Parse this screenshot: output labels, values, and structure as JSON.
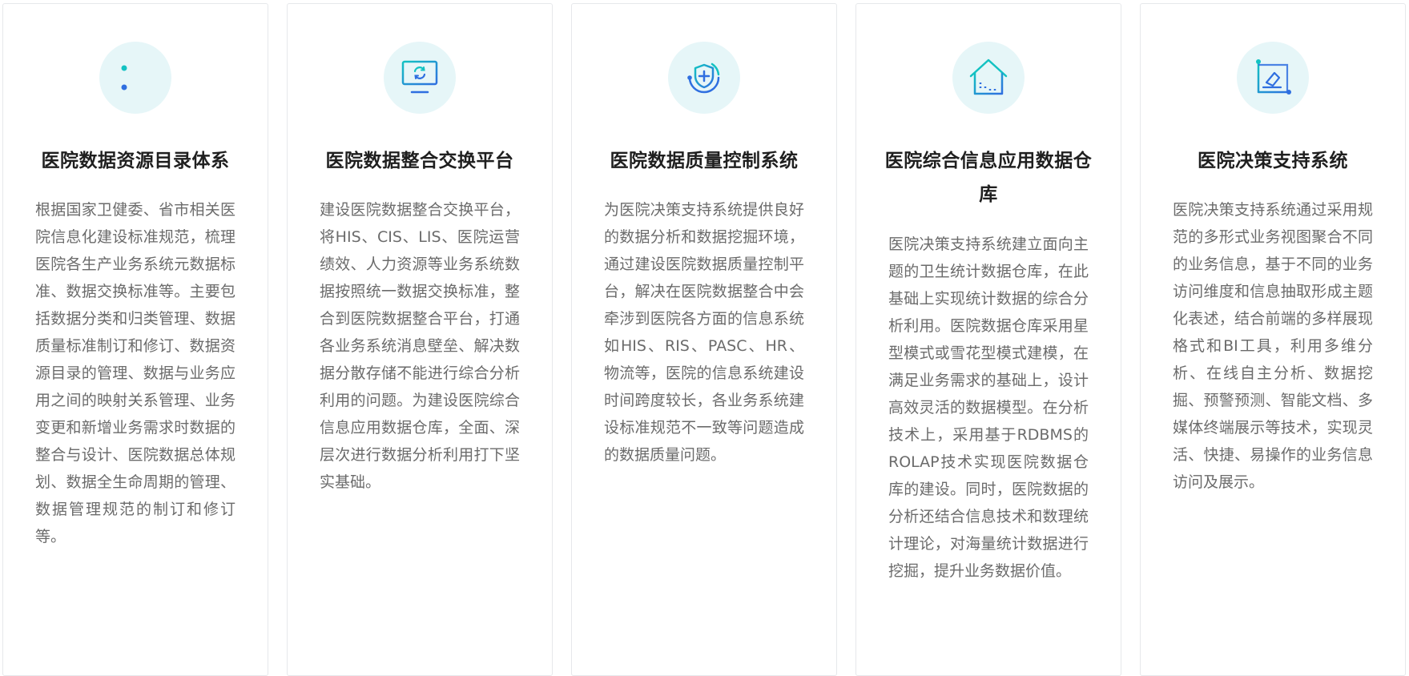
{
  "colors": {
    "icon_bg": "#e6f6f8",
    "icon_gradient_start": "#13c2c2",
    "icon_gradient_end": "#2f6fe0",
    "title": "#1f1f1f",
    "body_text": "#6b6b6b",
    "card_border": "#e6e8eb"
  },
  "cards": [
    {
      "icon": "list-catalog-icon",
      "title": "医院数据资源目录体系",
      "description": "根据国家卫健委、省市相关医院信息化建设标准规范，梳理医院各生产业务系统元数据标准、数据交换标准等。主要包括数据分类和归类管理、数据质量标准制订和修订、数据资源目录的管理、数据与业务应用之间的映射关系管理、业务变更和新增业务需求时数据的整合与设计、医院数据总体规划、数据全生命周期的管理、数据管理规范的制订和修订等。"
    },
    {
      "icon": "monitor-refresh-icon",
      "title": "医院数据整合交换平台",
      "description": "建设医院数据整合交换平台，将HIS、CIS、LIS、医院运营绩效、人力资源等业务系统数据按照统一数据交换标准，整合到医院数据整合平台，打通各业务系统消息壁垒、解决数据分散存储不能进行综合分析利用的问题。为建设医院综合信息应用数据仓库，全面、深层次进行数据分析利用打下坚实基础。"
    },
    {
      "icon": "shield-plus-icon",
      "title": "医院数据质量控制系统",
      "description": "为医院决策支持系统提供良好的数据分析和数据挖掘环境，通过建设医院数据质量控制平台，解决在医院数据整合中会牵涉到医院各方面的信息系统如HIS、RIS、PASC、HR、物流等，医院的信息系统建设时间跨度较长，各业务系统建设标准规范不一致等问题造成的数据质量问题。"
    },
    {
      "icon": "warehouse-house-icon",
      "title": "医院综合信息应用数据仓库",
      "description": "医院决策支持系统建立面向主题的卫生统计数据仓库，在此基础上实现统计数据的综合分析利用。医院数据仓库采用星型模式或雪花型模式建模，在满足业务需求的基础上，设计高效灵活的数据模型。在分析技术上，采用基于RDBMS的ROLAP技术实现医院数据仓库的建设。同时，医院数据的分析还结合信息技术和数理统计理论，对海量统计数据进行挖掘，提升业务数据价值。"
    },
    {
      "icon": "decision-chart-icon",
      "title": "医院决策支持系统",
      "description": "医院决策支持系统通过采用规范的多形式业务视图聚合不同的业务信息，基于不同的业务访问维度和信息抽取形成主题化表述，结合前端的多样展现格式和BI工具，利用多维分析、在线自主分析、数据挖掘、预警预测、智能文档、多媒体终端展示等技术，实现灵活、快捷、易操作的业务信息访问及展示。"
    }
  ]
}
